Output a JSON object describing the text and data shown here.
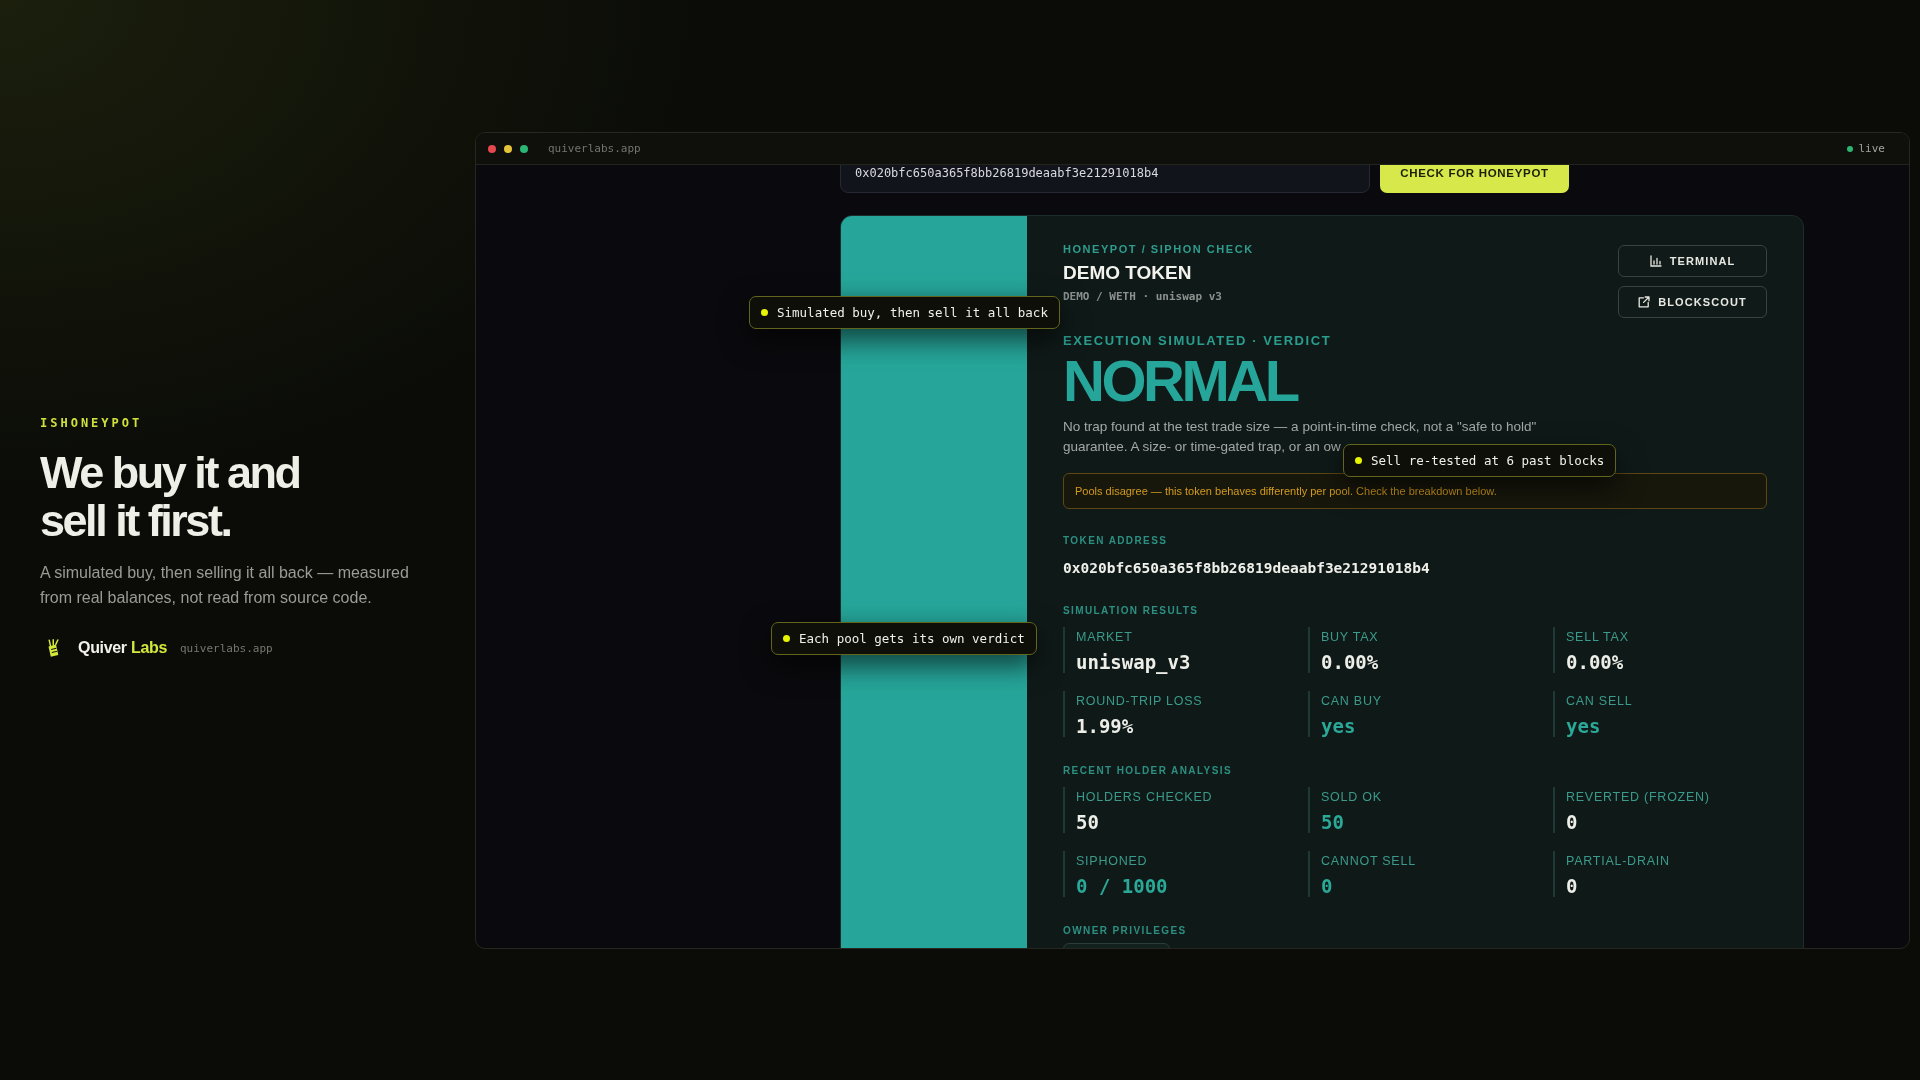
{
  "intro": {
    "eyebrow": "ISHONEYPOT",
    "headline": "We buy it and\nsell it first.",
    "description": "A simulated buy, then selling it all back — measured from real balances, not read from source code.",
    "brand": {
      "name": "Quiver",
      "name_accent": "Labs",
      "domain": "quiverlabs.app"
    }
  },
  "window": {
    "url": "quiverlabs.app",
    "status": "live"
  },
  "search": {
    "value": "0x020bfc650a365f8bb26819deaabf3e21291018b4",
    "button": "CHECK FOR HONEYPOT"
  },
  "result": {
    "eyebrow": "HONEYPOT / SIPHON CHECK",
    "title": "DEMO TOKEN",
    "pair": "DEMO / WETH · uniswap v3",
    "actions": [
      {
        "kind": "terminal",
        "label": "TERMINAL"
      },
      {
        "kind": "explorer",
        "label": "BLOCKSCOUT"
      }
    ],
    "verdict_label": "EXECUTION SIMULATED · VERDICT",
    "verdict": "NORMAL",
    "note": "No trap found at the test trade size — a point-in-time check, not a \"safe to hold\"\nguarantee. A size- or time-gated trap, or an ow",
    "warning": "Pools disagree — this token behaves differently per pool. Check the breakdown below.",
    "token_address": {
      "label": "TOKEN ADDRESS",
      "value": "0x020bfc650a365f8bb26819deaabf3e21291018b4"
    },
    "sections": [
      {
        "kind": "stats",
        "title": "SIMULATION RESULTS",
        "stats": [
          {
            "label": "MARKET",
            "value": "uniswap_v3",
            "color": "#eeeee8"
          },
          {
            "label": "BUY TAX",
            "value": "0.00%",
            "color": "#eeeee8"
          },
          {
            "label": "SELL TAX",
            "value": "0.00%",
            "color": "#eeeee8"
          },
          {
            "label": "ROUND-TRIP LOSS",
            "value": "1.99%",
            "color": "#eeeee8"
          },
          {
            "label": "CAN BUY",
            "value": "yes",
            "color": "#2aa898"
          },
          {
            "label": "CAN SELL",
            "value": "yes",
            "color": "#2aa898"
          }
        ]
      },
      {
        "kind": "stats",
        "title": "RECENT HOLDER ANALYSIS",
        "stats": [
          {
            "label": "HOLDERS CHECKED",
            "value": "50",
            "color": "#eeeee8"
          },
          {
            "label": "SOLD OK",
            "value": "50",
            "color": "#2aa898"
          },
          {
            "label": "REVERTED (FROZEN)",
            "value": "0",
            "color": "#eeeee8"
          },
          {
            "label": "SIPHONED",
            "value": "0 / 1000",
            "color": "#2aa898"
          },
          {
            "label": "CANNOT SELL",
            "value": "0",
            "color": "#2aa898"
          },
          {
            "label": "PARTIAL-DRAIN",
            "value": "0",
            "color": "#eeeee8"
          }
        ]
      },
      {
        "kind": "privileges",
        "title": "OWNER PRIVILEGES"
      }
    ]
  },
  "callouts": [
    {
      "text": "Simulated buy, then sell it all back"
    },
    {
      "text": "Sell re-tested at 6 past blocks"
    },
    {
      "text": "Each pool gets its own verdict"
    }
  ]
}
